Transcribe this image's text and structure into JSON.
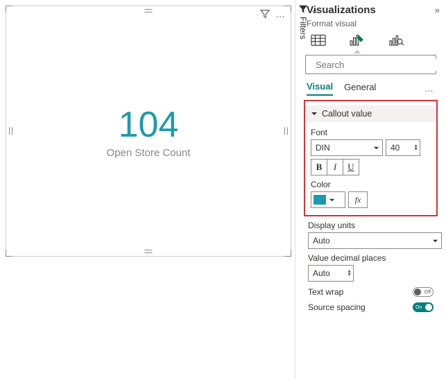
{
  "canvas": {
    "value": "104",
    "caption": "Open Store Count"
  },
  "filters_label": "Filters",
  "panel": {
    "title": "Visualizations",
    "subtitle": "Format visual",
    "search_placeholder": "Search",
    "tabs": {
      "visual": "Visual",
      "general": "General"
    },
    "callout": {
      "section_title": "Callout value",
      "font_label": "Font",
      "font_family": "DIN",
      "font_size": "40",
      "bold": "B",
      "italic": "I",
      "underline": "U",
      "color_label": "Color",
      "color_hex": "#1f9aac",
      "fx": "fx"
    },
    "display_units": {
      "label": "Display units",
      "value": "Auto"
    },
    "decimals": {
      "label": "Value decimal places",
      "value": "Auto"
    },
    "text_wrap": {
      "label": "Text wrap",
      "state": "Off"
    },
    "source_spacing": {
      "label": "Source spacing",
      "state": "On"
    }
  },
  "chart_data": {
    "type": "card",
    "title": "Open Store Count",
    "value": 104,
    "format": {
      "font": "DIN",
      "size": 40,
      "color": "#1f9aac"
    }
  }
}
